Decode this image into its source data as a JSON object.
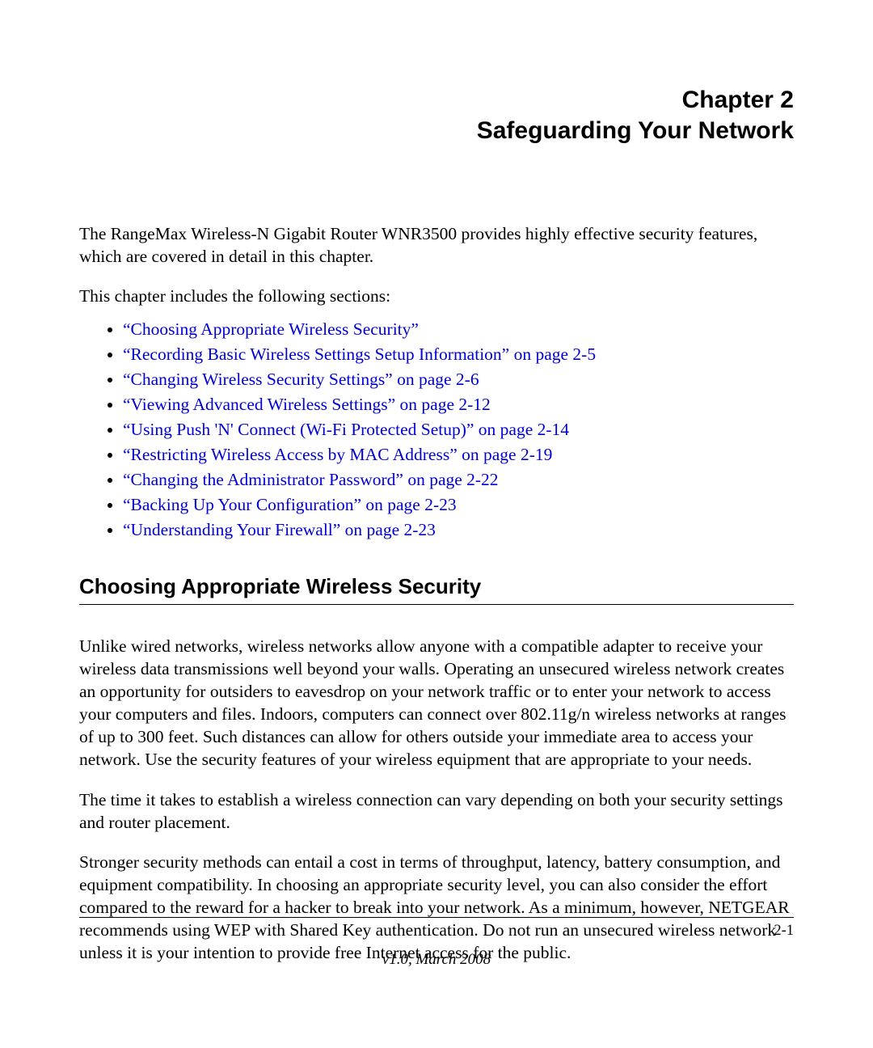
{
  "chapter": {
    "number_line": "Chapter 2",
    "title_line": "Safeguarding Your Network"
  },
  "intro": {
    "p1": "The RangeMax Wireless-N Gigabit Router WNR3500 provides highly effective security features, which are covered in detail in this chapter.",
    "p2": "This chapter includes the following sections:"
  },
  "sections": [
    "“Choosing Appropriate Wireless Security”",
    "“Recording Basic Wireless Settings Setup Information” on page 2-5",
    "“Changing Wireless Security Settings” on page 2-6",
    "“Viewing Advanced Wireless Settings” on page 2-12",
    "“Using Push 'N' Connect (Wi-Fi Protected Setup)” on page 2-14",
    "“Restricting Wireless Access by MAC Address” on page 2-19",
    "“Changing the Administrator Password” on page 2-22",
    "“Backing Up Your Configuration” on page 2-23",
    "“Understanding Your Firewall” on page 2-23"
  ],
  "heading1": "Choosing Appropriate Wireless Security",
  "body": {
    "p1": "Unlike wired networks, wireless networks allow anyone with a compatible adapter to receive your wireless data transmissions well beyond your walls. Operating an unsecured wireless network creates an opportunity for outsiders to eavesdrop on your network traffic or to enter your network to access your computers and files. Indoors, computers can connect over 802.11g/n wireless networks at ranges of up to 300 feet. Such distances can allow for others outside your immediate area to access your network. Use the security features of your wireless equipment that are appropriate to your needs.",
    "p2": "The time it takes to establish a wireless connection can vary depending on both your security settings and router placement.",
    "p3": "Stronger security methods can entail a cost in terms of throughput, latency, battery consumption, and equipment compatibility. In choosing an appropriate security level, you can also consider the effort compared to the reward for a hacker to break into your network. As a minimum, however, NETGEAR recommends using WEP with Shared Key authentication. Do not run an unsecured wireless network unless it is your intention to provide free Internet access for the public."
  },
  "footer": {
    "page": "2-1",
    "version": "v1.0, March 2008"
  }
}
